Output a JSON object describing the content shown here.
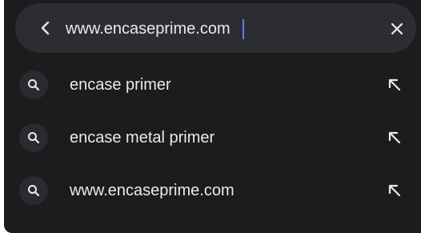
{
  "search_bar": {
    "url_value": "www.encaseprime.com",
    "back_icon": "chevron-left-icon",
    "clear_icon": "close-icon"
  },
  "suggestions": [
    {
      "text": "encase primer",
      "icon": "search-icon",
      "action_icon": "arrow-up-left-icon"
    },
    {
      "text": "encase metal primer",
      "icon": "search-icon",
      "action_icon": "arrow-up-left-icon"
    },
    {
      "text": "www.encaseprime.com",
      "icon": "search-icon",
      "action_icon": "arrow-up-left-icon"
    }
  ],
  "colors": {
    "background": "#1c1c1e",
    "search_bar": "#2c2d31",
    "text": "#e8eaed",
    "caret": "#5a7dff"
  }
}
